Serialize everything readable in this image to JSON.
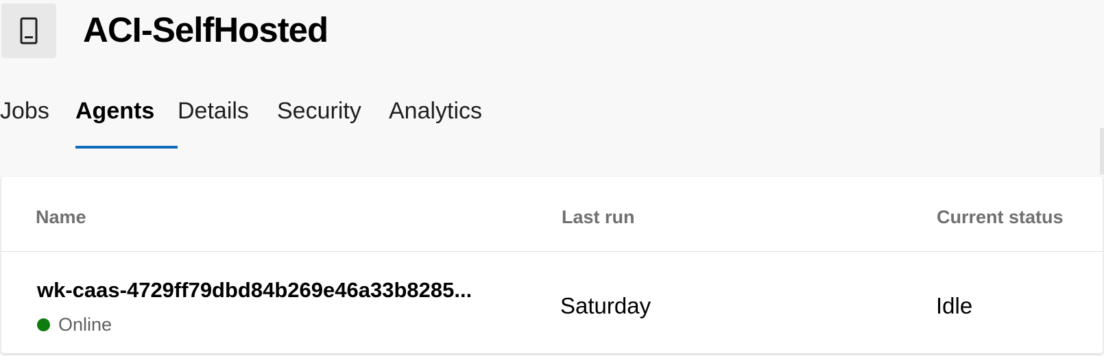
{
  "header": {
    "title": "ACI-SelfHosted",
    "icon": "device-icon"
  },
  "tabs": [
    {
      "label": "Jobs",
      "active": false
    },
    {
      "label": "Agents",
      "active": true
    },
    {
      "label": "Details",
      "active": false
    },
    {
      "label": "Security",
      "active": false
    },
    {
      "label": "Analytics",
      "active": false
    }
  ],
  "table": {
    "columns": {
      "name": "Name",
      "last_run": "Last run",
      "current_status": "Current status"
    },
    "rows": [
      {
        "name": "wk-caas-4729ff79dbd84b269e46a33b8285...",
        "status": "Online",
        "last_run": "Saturday",
        "current_status": "Idle"
      }
    ]
  },
  "colors": {
    "accent": "#0f6cbd",
    "online": "#107c10"
  }
}
